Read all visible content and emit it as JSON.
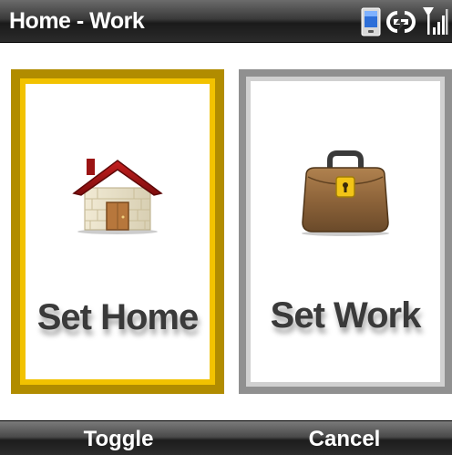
{
  "title_bar": {
    "title": "Home - Work",
    "icons": [
      "device-icon",
      "connection-icon",
      "signal-strength-icon"
    ]
  },
  "options": [
    {
      "label": "Set Home",
      "icon": "house-icon",
      "selected": true
    },
    {
      "label": "Set Work",
      "icon": "briefcase-icon",
      "selected": false
    }
  ],
  "softkeys": {
    "left": "Toggle",
    "right": "Cancel"
  },
  "colors": {
    "selected_border": "#b18c00",
    "selected_highlight": "#f2c200",
    "unselected_border": "#909090"
  }
}
